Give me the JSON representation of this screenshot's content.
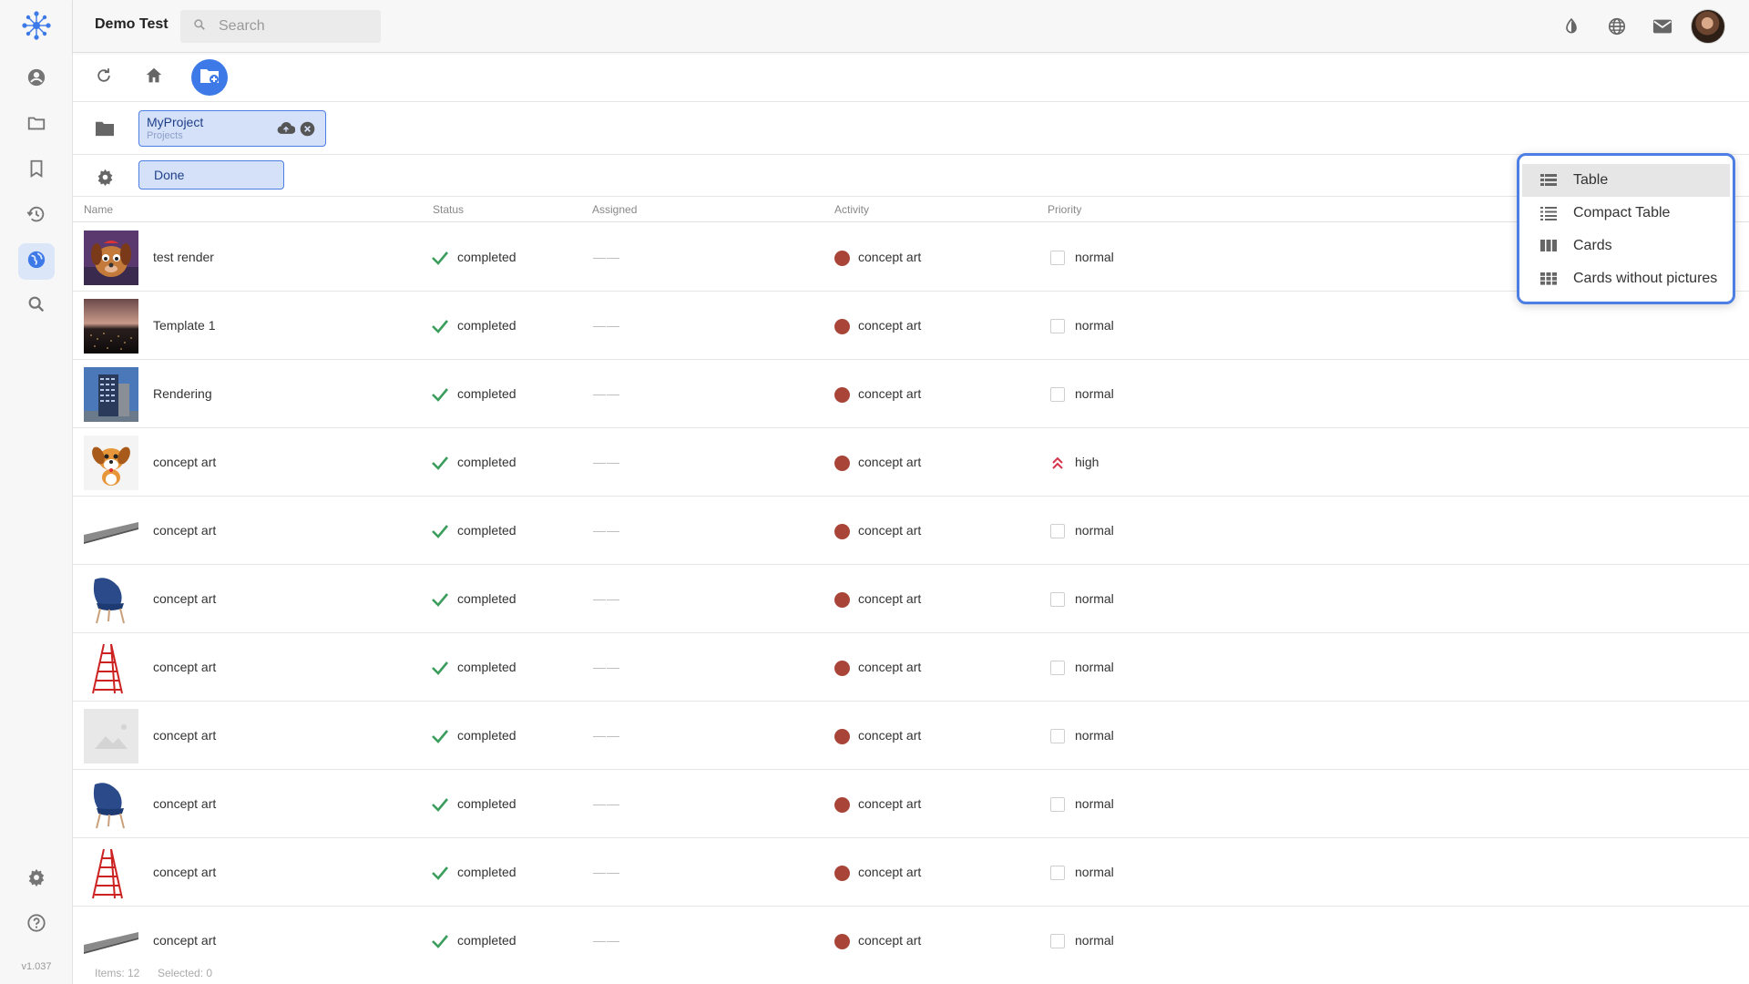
{
  "app": {
    "title": "Demo Test",
    "version": "v1.037",
    "search_placeholder": "Search",
    "accent_color": "#3d7ae8"
  },
  "rail": {
    "items": [
      "profile-icon",
      "folder-icon",
      "bookmark-icon",
      "history-icon",
      "globe-icon",
      "search-icon"
    ],
    "active": "globe-icon",
    "bottom_items": [
      "settings-icon",
      "help-icon"
    ]
  },
  "topbar_icons": [
    "contrast-icon",
    "language-globe-icon",
    "mail-icon",
    "user-avatar"
  ],
  "toolbar_icons": [
    "refresh-icon",
    "home-icon",
    "new-folder-icon"
  ],
  "filters": {
    "project": {
      "title": "MyProject",
      "subtitle": "Projects"
    },
    "status": {
      "title": "Done"
    }
  },
  "table": {
    "columns": {
      "name": "Name",
      "status": "Status",
      "assigned": "Assigned",
      "activity": "Activity",
      "priority": "Priority"
    },
    "rows": [
      {
        "name": "test render",
        "status": "completed",
        "assigned": "——",
        "activity": "concept art",
        "priority": "normal",
        "thumb": "cartoon-dog-render"
      },
      {
        "name": "Template 1",
        "status": "completed",
        "assigned": "——",
        "activity": "concept art",
        "priority": "normal",
        "thumb": "city-night"
      },
      {
        "name": "Rendering",
        "status": "completed",
        "assigned": "——",
        "activity": "concept art",
        "priority": "normal",
        "thumb": "building"
      },
      {
        "name": "concept art",
        "status": "completed",
        "assigned": "——",
        "activity": "concept art",
        "priority": "high",
        "thumb": "cartoon-puppy"
      },
      {
        "name": "concept art",
        "status": "completed",
        "assigned": "——",
        "activity": "concept art",
        "priority": "normal",
        "thumb": "gray-beam"
      },
      {
        "name": "concept art",
        "status": "completed",
        "assigned": "——",
        "activity": "concept art",
        "priority": "normal",
        "thumb": "blue-chair"
      },
      {
        "name": "concept art",
        "status": "completed",
        "assigned": "——",
        "activity": "concept art",
        "priority": "normal",
        "thumb": "red-ladder"
      },
      {
        "name": "concept art",
        "status": "completed",
        "assigned": "——",
        "activity": "concept art",
        "priority": "normal",
        "thumb": "placeholder"
      },
      {
        "name": "concept art",
        "status": "completed",
        "assigned": "——",
        "activity": "concept art",
        "priority": "normal",
        "thumb": "blue-chair"
      },
      {
        "name": "concept art",
        "status": "completed",
        "assigned": "——",
        "activity": "concept art",
        "priority": "normal",
        "thumb": "red-ladder"
      },
      {
        "name": "concept art",
        "status": "completed",
        "assigned": "——",
        "activity": "concept art",
        "priority": "normal",
        "thumb": "gray-beam"
      }
    ]
  },
  "footer": {
    "items": "Items: 12",
    "selected": "Selected: 0"
  },
  "view_menu": {
    "options": [
      {
        "label": "Table",
        "icon": "table-icon",
        "selected": true
      },
      {
        "label": "Compact Table",
        "icon": "list-icon",
        "selected": false
      },
      {
        "label": "Cards",
        "icon": "columns-icon",
        "selected": false
      },
      {
        "label": "Cards without pictures",
        "icon": "grid-icon",
        "selected": false
      }
    ]
  },
  "colors": {
    "completed_check": "#3a9d5c",
    "activity_dot": "#a94538",
    "high_priority": "#d6334c",
    "chip_bg": "#d5e1f9",
    "chip_border": "#4d7ee4"
  }
}
